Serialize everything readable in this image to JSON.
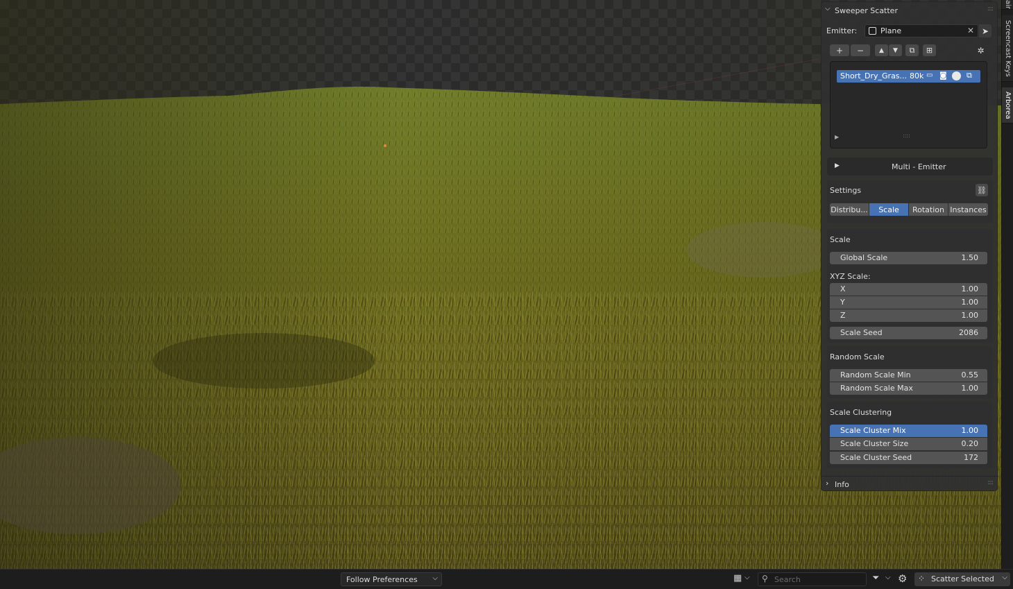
{
  "panel": {
    "title": "Sweeper Scatter",
    "emitter_label": "Emitter:",
    "emitter_value": "Plane",
    "list_item": {
      "name": "Short_Dry_Gras...",
      "count": "80k"
    },
    "multi_emitter": "Multi - Emitter",
    "settings_label": "Settings",
    "tabs": [
      "Distribu...",
      "Scale",
      "Rotation",
      "Instances"
    ],
    "active_tab": "Scale",
    "scale": {
      "header": "Scale",
      "global_scale": {
        "label": "Global Scale",
        "value": "1.50"
      },
      "xyz_label": "XYZ Scale:",
      "x": {
        "label": "X",
        "value": "1.00"
      },
      "y": {
        "label": "Y",
        "value": "1.00"
      },
      "z": {
        "label": "Z",
        "value": "1.00"
      },
      "seed": {
        "label": "Scale Seed",
        "value": "2086"
      }
    },
    "random_scale": {
      "header": "Random Scale",
      "min": {
        "label": "Random Scale Min",
        "value": "0.55"
      },
      "max": {
        "label": "Random Scale Max",
        "value": "1.00"
      }
    },
    "clustering": {
      "header": "Scale Clustering",
      "mix": {
        "label": "Scale Cluster Mix",
        "value": "1.00"
      },
      "size": {
        "label": "Scale Cluster Size",
        "value": "0.20"
      },
      "seed": {
        "label": "Scale Cluster Seed",
        "value": "172"
      }
    },
    "info_label": "Info"
  },
  "side_tabs": [
    "air",
    "Screencast Keys",
    "Arborea"
  ],
  "statusbar": {
    "dropdown": "Follow Preferences",
    "search_placeholder": "Search",
    "scatter_button": "Scatter Selected"
  },
  "colors": {
    "accent": "#4772b3",
    "panel_bg": "#303030",
    "field_bg": "#545454"
  }
}
